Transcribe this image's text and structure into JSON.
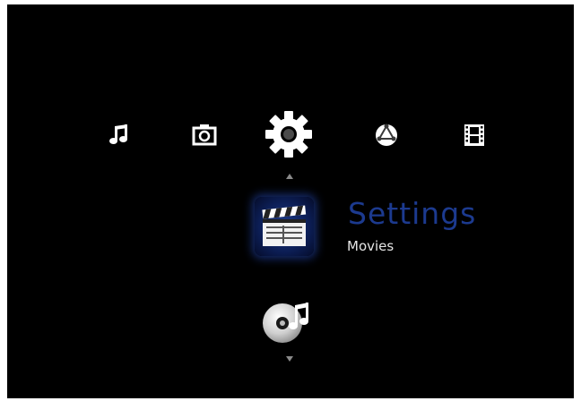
{
  "menu": {
    "categories": [
      {
        "id": "music",
        "icon": "music-note-icon"
      },
      {
        "id": "photos",
        "icon": "camera-icon"
      },
      {
        "id": "settings",
        "icon": "gear-icon",
        "selected": true
      },
      {
        "id": "network",
        "icon": "network-globe-icon"
      },
      {
        "id": "videos",
        "icon": "film-strip-icon"
      }
    ],
    "section_title": "Settings",
    "current_item": {
      "label": "Movies",
      "icon": "clapperboard-icon"
    },
    "next_item": {
      "icon": "music-disc-icon"
    }
  },
  "colors": {
    "background": "#000000",
    "title": "#1c3a8f",
    "label": "#e6e6e6",
    "highlight": "#1e3c8c"
  }
}
